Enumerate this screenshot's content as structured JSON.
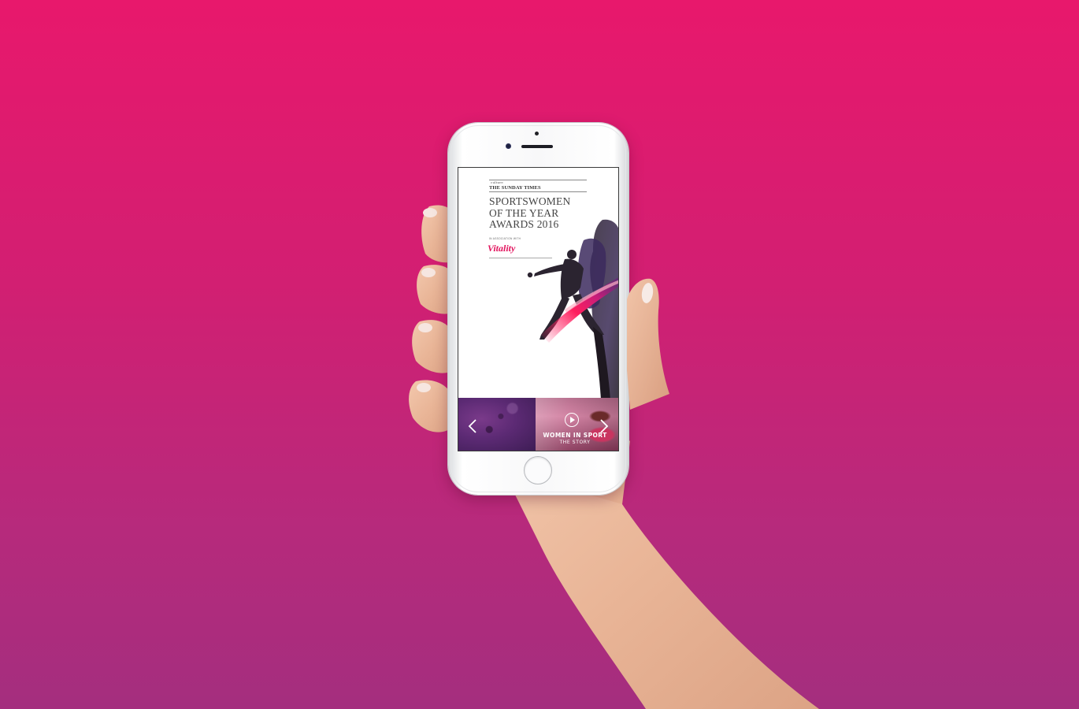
{
  "screen": {
    "masthead_small": "culture",
    "masthead": "THE SUNDAY TIMES",
    "title_lines": [
      "SPORTSWOMEN",
      "OF THE YEAR",
      "AWARDS 2016"
    ],
    "association_text": "IN ASSOCIATION WITH",
    "sponsor": "Vitality"
  },
  "carousel": {
    "slide_title": "WOMEN IN SPORT",
    "slide_subtitle": "THE STORY",
    "prev_icon": "chevron-left-icon",
    "next_icon": "chevron-right-icon",
    "play_icon": "play-circle-icon"
  },
  "colors": {
    "background_top": "#E8186C",
    "background_bottom": "#A42E7E",
    "brand_accent": "#E2135D",
    "phone_body": "#F8F8F9"
  }
}
